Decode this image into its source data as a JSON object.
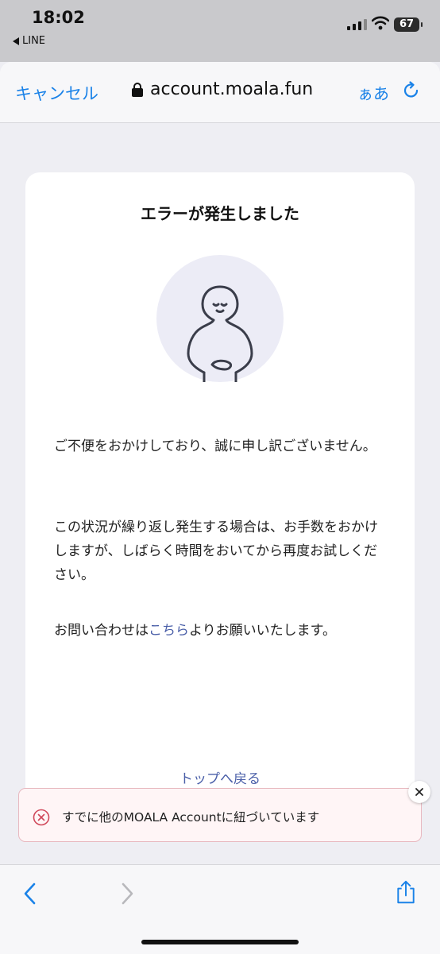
{
  "status_bar": {
    "time": "18:02",
    "back_app_label": "LINE",
    "battery_level": "67"
  },
  "browser": {
    "cancel_label": "キャンセル",
    "url": "account.moala.fun",
    "text_size_label": "ぁあ",
    "accent_color": "#1a82e8"
  },
  "card": {
    "title": "エラーが発生しました",
    "paragraph1": "ご不便をおかけしており、誠に申し訳ございません。",
    "paragraph2": "この状況が繰り返し発生する場合は、お手数をおかけしますが、しばらく時間をおいてから再度お試しください。",
    "contact_prefix": "お問い合わせは",
    "contact_link": "こちら",
    "contact_suffix": "よりお願いいたします。",
    "top_link": "トップへ戻る",
    "link_color": "#4a5fa8"
  },
  "toast": {
    "message": "すでに他のMOALA Accountに紐づいています",
    "icon": "error-circle-x-icon",
    "border_color": "#e8b9c0"
  },
  "bottom_bar": {
    "icons": [
      "back-arrow-icon",
      "forward-arrow-icon",
      "share-icon"
    ]
  }
}
